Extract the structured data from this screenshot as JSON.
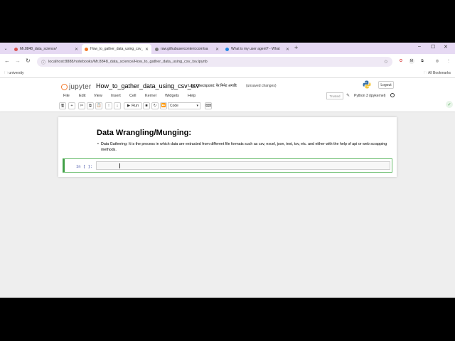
{
  "browser": {
    "tabs": [
      {
        "label": "Mr.8848_data_science/",
        "fav_color": "#d9534f",
        "active": false
      },
      {
        "label": "How_to_gather_data_using_csv_",
        "fav_color": "#f37626",
        "active": true
      },
      {
        "label": "raw.githubusercontent.com/sa",
        "fav_color": "#7a7a7a",
        "active": false
      },
      {
        "label": "What is my user agent? - What",
        "fav_color": "#1e88e5",
        "active": false
      }
    ],
    "url": "localhost:8888/notebooks/Mr.8848_data_science/How_to_gather_data_using_csv_tsv.ipynb",
    "bookmarks": {
      "university": "university",
      "all_bookmarks": "All Bookmarks"
    }
  },
  "jupyter": {
    "logo_text": "jupyter",
    "notebook_name": "How_to_gather_data_using_csv_tsv",
    "checkpoint": "Last Checkpoint: पेर मिनेट अगाडि",
    "unsaved": "(unsaved changes)",
    "logout": "Logout",
    "menu": [
      "File",
      "Edit",
      "View",
      "Insert",
      "Cell",
      "Kernel",
      "Widgets",
      "Help"
    ],
    "trusted": "Trusted",
    "kernel": "Python 3 (ipykernel)",
    "toolbar": {
      "run": "Run",
      "cell_type": "Code"
    }
  },
  "notebook": {
    "md_title": "Data Wrangling/Munging:",
    "md_bullet": "Data Gathering: It is the process in which data are extracted from different file formats such as csv, excel, json, text, tsv, etc. and either with the help of api or web scrapping methods.",
    "prompt": "In [ ]:"
  },
  "colors": {
    "tabstrip": "#e6d9f3",
    "accent_green": "#42a047",
    "jupyter_orange": "#f37626"
  }
}
